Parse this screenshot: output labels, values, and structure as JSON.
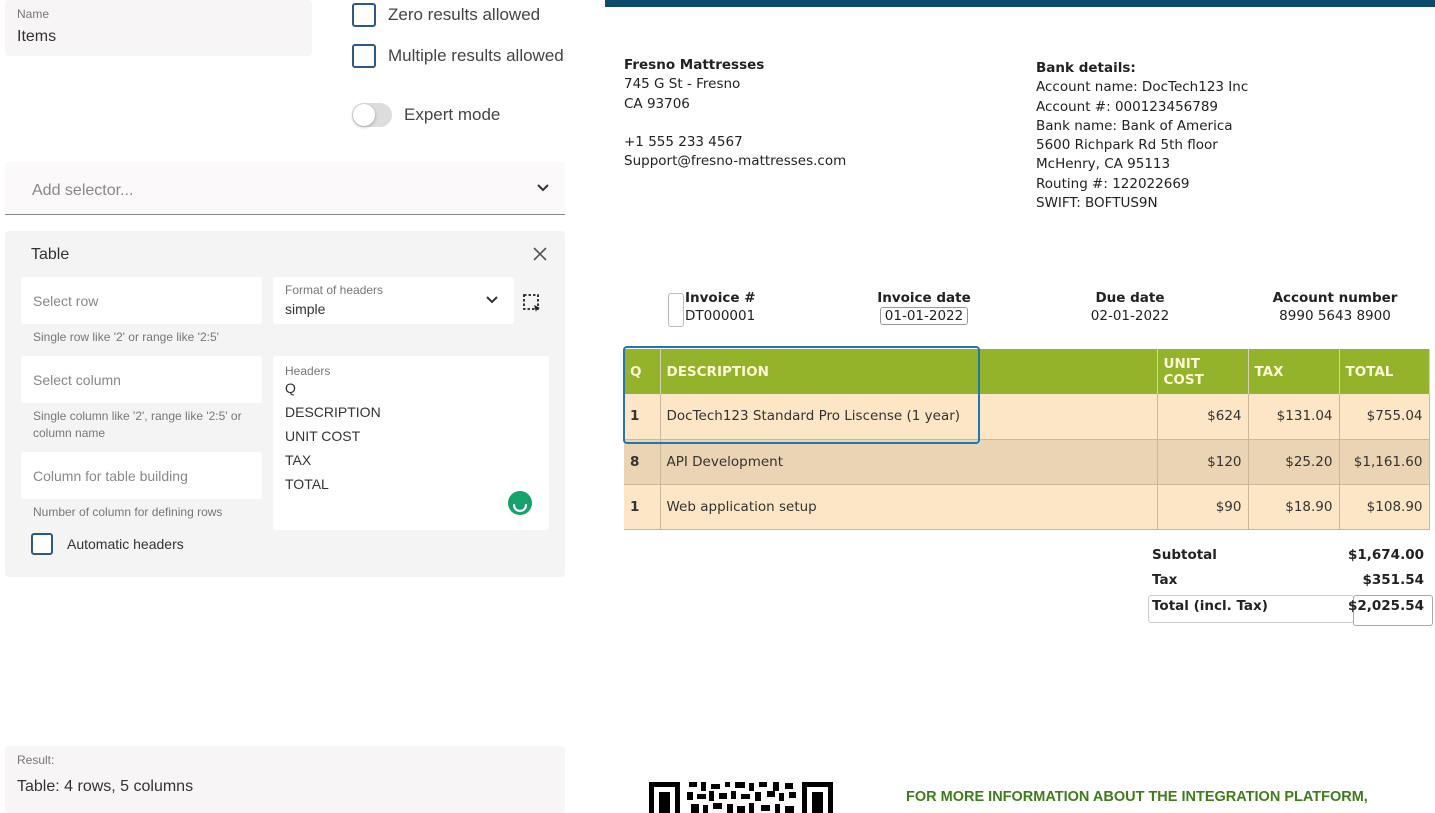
{
  "config": {
    "name_label": "Name",
    "name_value": "Items",
    "zero_results_label": "Zero results allowed",
    "multiple_results_label": "Multiple results allowed",
    "expert_mode_label": "Expert mode",
    "add_selector_placeholder": "Add selector...",
    "table_card": {
      "title": "Table",
      "select_row_placeholder": "Select row",
      "select_row_hint": "Single row like '2' or range like '2:5'",
      "format_headers_label": "Format of headers",
      "format_headers_value": "simple",
      "select_column_placeholder": "Select column",
      "select_column_hint": "Single column like '2', range like '2:5' or column name",
      "column_building_placeholder": "Column for table building",
      "column_building_hint": "Number of column for defining rows",
      "headers_label": "Headers",
      "headers": [
        "Q",
        "DESCRIPTION",
        "UNIT COST",
        "TAX",
        "TOTAL"
      ],
      "automatic_headers_label": "Automatic headers"
    },
    "result_label": "Result:",
    "result_value": "Table: 4 rows, 5 columns"
  },
  "invoice": {
    "company": {
      "name": "Fresno Mattresses",
      "address1": "745 G St - Fresno",
      "address2": "CA 93706",
      "phone": "+1 555 233 4567",
      "email": "Support@fresno-mattresses.com"
    },
    "bank": {
      "title": "Bank details:",
      "account_name": "Account name: DocTech123 Inc",
      "account_number": "Account #: 000123456789",
      "bank_name": "Bank name: Bank of America",
      "address1": "5600 Richpark Rd 5th floor",
      "address2": "McHenry, CA 95113",
      "routing": "Routing #: 122022669",
      "swift": "SWIFT: BOFTUS9N"
    },
    "meta": {
      "invoice_no_label": "Invoice #",
      "invoice_no": "DT000001",
      "invoice_date_label": "Invoice date",
      "invoice_date": "01-01-2022",
      "due_date_label": "Due date",
      "due_date": "02-01-2022",
      "account_number_label": "Account number",
      "account_number": "8990 5643 8900"
    },
    "table": {
      "headers": [
        "Q",
        "DESCRIPTION",
        "UNIT COST",
        "TAX",
        "TOTAL"
      ],
      "rows": [
        {
          "q": "1",
          "desc": "DocTech123 Standard Pro Liscense (1 year)",
          "unit": "$624",
          "tax": "$131.04",
          "total": "$755.04"
        },
        {
          "q": "8",
          "desc": "API Development",
          "unit": "$120",
          "tax": "$25.20",
          "total": "$1,161.60"
        },
        {
          "q": "1",
          "desc": "Web application setup",
          "unit": "$90",
          "tax": "$18.90",
          "total": "$108.90"
        }
      ]
    },
    "totals": {
      "subtotal_label": "Subtotal",
      "subtotal": "$1,674.00",
      "tax_label": "Tax",
      "tax": "$351.54",
      "total_label": "Total (incl. Tax)",
      "total": "$2,025.54"
    },
    "more_info": "FOR MORE INFORMATION ABOUT THE INTEGRATION PLATFORM,"
  },
  "icons": {
    "chevron": "chevron-down-icon",
    "close": "close-icon",
    "area_select": "area-select-icon",
    "spinner": "loading-icon",
    "qr": "qr-code"
  },
  "colors": {
    "accent": "#2b5a8a",
    "doc_header_bar": "#0c4a6e",
    "table_header": "#93b32b",
    "row_light": "#fde6c6",
    "row_dark": "#ead4b4",
    "selection": "#1f78b4",
    "more_info_text": "#3f7c1a"
  }
}
